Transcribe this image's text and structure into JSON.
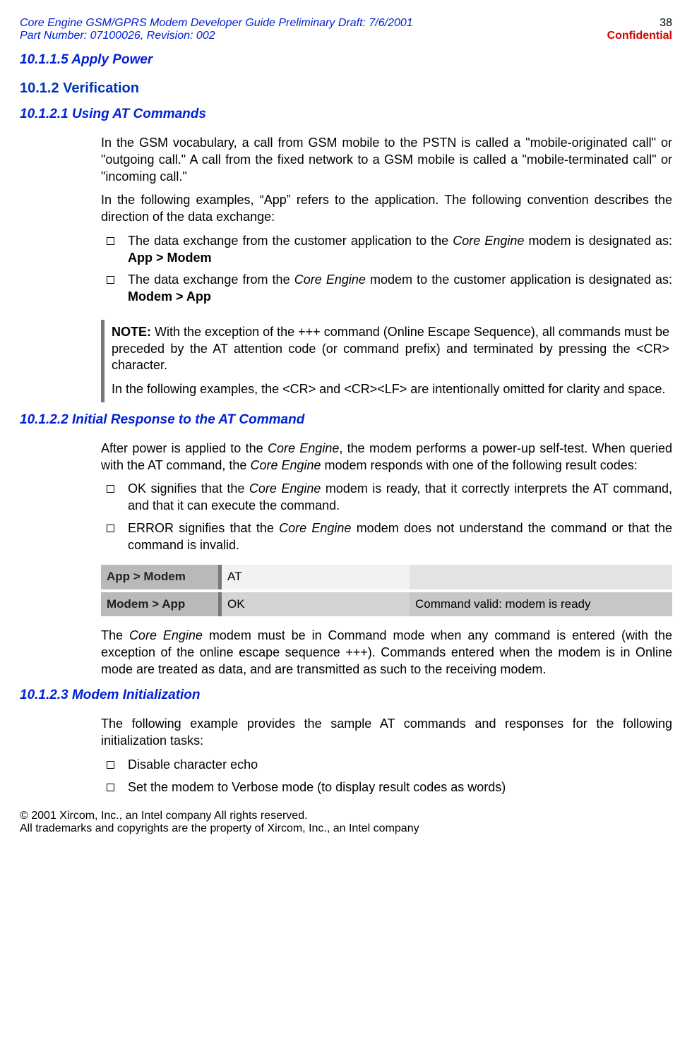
{
  "header": {
    "left1": "Core Engine GSM/GPRS Modem Developer Guide Preliminary Draft: 7/6/2001",
    "left2": "Part Number: 07100026, Revision: 002",
    "page": "38",
    "confidential": "Confidential"
  },
  "sec1": {
    "h": "10.1.1.5 Apply Power"
  },
  "sec2": {
    "h": "10.1.2 Verification"
  },
  "sec3": {
    "h": "10.1.2.1 Using AT Commands",
    "p1a": "In the GSM vocabulary, a call from GSM mobile to the PSTN is called a \"mobile-originated call\" or \"outgoing call.\" A call from the fixed network to a GSM mobile is called a \"mobile-terminated call\" or \"incoming call.\"",
    "p2a": "In the following examples, “App” refers to the application. The following convention describes the direction of the data exchange:",
    "li1a": "The data exchange from the customer application to the ",
    "li1b": "Core Engine",
    "li1c": " modem is designated as: ",
    "li1d": "App > Modem",
    "li2a": "The data exchange from the ",
    "li2b": "Core Engine",
    "li2c": " modem to the customer application is designated as: ",
    "li2d": "Modem > App",
    "note1_label": "NOTE:",
    "note1_body": " With the exception of the +++ command (Online Escape Sequence), all commands must be preceded by the AT attention code (or command prefix) and terminated by pressing the <CR> character.",
    "note2": "In the following examples, the <CR> and <CR><LF> are intentionally omitted for clarity and space."
  },
  "sec4": {
    "h": "10.1.2.2 Initial Response to the AT Command",
    "p1a": "After power is applied to the ",
    "p1b": "Core Engine",
    "p1c": ", the modem performs a power-up self-test. When queried with the AT command, the ",
    "p1d": "Core Engine",
    "p1e": " modem responds with one of the following result codes:",
    "li1a": "OK signifies that the ",
    "li1b": "Core Engine",
    "li1c": " modem is ready, that it correctly interprets the AT command, and that it can execute the command.",
    "li2a": "ERROR signifies that the ",
    "li2b": "Core Engine",
    "li2c": " modem does not understand the command or that the command is invalid.",
    "table": {
      "r1c1": "App > Modem",
      "r1c2": "AT",
      "r1c3": "",
      "r2c1": "Modem > App",
      "r2c2": "OK",
      "r2c3": "Command valid: modem is ready"
    },
    "p2a": "The ",
    "p2b": "Core Engine",
    "p2c": " modem must be in Command mode when any command is entered (with the exception of the online escape sequence +++). Commands entered when the modem is in Online mode are treated as data, and are transmitted as such to the receiving modem."
  },
  "sec5": {
    "h": "10.1.2.3 Modem Initialization",
    "p1": "The following example provides the sample AT commands and responses for the following initialization tasks:",
    "li1": "Disable character echo",
    "li2": "Set the modem to Verbose mode (to display result codes as words)"
  },
  "footer": {
    "l1": "© 2001 Xircom, Inc., an Intel company All rights reserved.",
    "l2": "All trademarks and copyrights are the property of Xircom, Inc., an Intel company"
  }
}
